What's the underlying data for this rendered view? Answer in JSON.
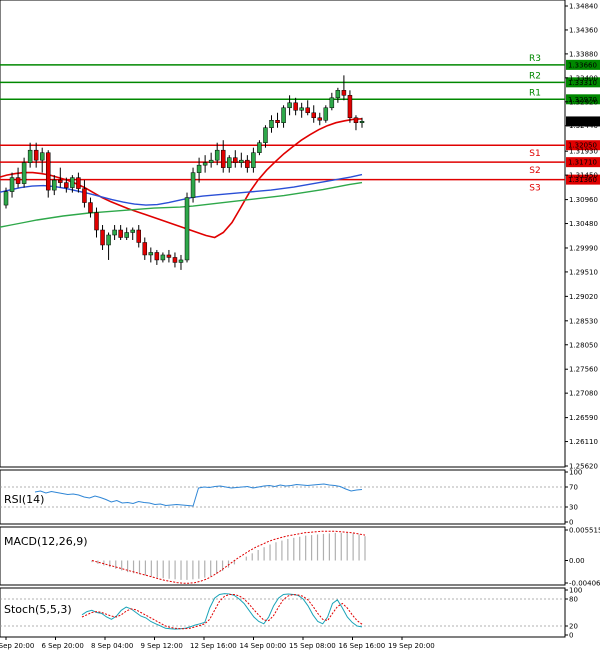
{
  "chart_data": {
    "type": "candlestick",
    "price_axis": {
      "ticks": [
        "1.34840",
        "1.34360",
        "1.33880",
        "1.33400",
        "1.32920",
        "1.32440",
        "1.31930",
        "1.31450",
        "1.30960",
        "1.30480",
        "1.29990",
        "1.29510",
        "1.29020",
        "1.28530",
        "1.28050",
        "1.27560",
        "1.27080",
        "1.26590",
        "1.26110",
        "1.25620"
      ],
      "range": [
        1.2562,
        1.3484
      ]
    },
    "time_axis": {
      "labels": [
        "5 Sep 20:00",
        "6 Sep 20:00",
        "8 Sep 04:00",
        "9 Sep 12:00",
        "12 Sep 16:00",
        "14 Sep 00:00",
        "15 Sep 08:00",
        "16 Sep 16:00",
        "19 Sep 20:00"
      ]
    },
    "levels": [
      {
        "name": "R3",
        "value": 1.3366,
        "label": "1.33660",
        "color": "#008800"
      },
      {
        "name": "R2",
        "value": 1.3331,
        "label": "1.33310",
        "color": "#008800"
      },
      {
        "name": "R1",
        "value": 1.3297,
        "label": "1.32970",
        "color": "#008800"
      },
      {
        "name": "S1",
        "value": 1.3205,
        "label": "1.32050",
        "color": "#e00000"
      },
      {
        "name": "S2",
        "value": 1.3171,
        "label": "1.31710",
        "color": "#e00000"
      },
      {
        "name": "S3",
        "value": 1.3136,
        "label": "1.31360",
        "color": "#e00000"
      }
    ],
    "current_price": {
      "value": 1.32526,
      "label": "1.32526"
    },
    "candles": [
      [
        1.3085,
        1.312,
        1.3078,
        1.3112
      ],
      [
        1.3112,
        1.315,
        1.31,
        1.314
      ],
      [
        1.314,
        1.316,
        1.312,
        1.3128
      ],
      [
        1.3128,
        1.318,
        1.312,
        1.317
      ],
      [
        1.317,
        1.321,
        1.316,
        1.3195
      ],
      [
        1.3195,
        1.321,
        1.316,
        1.3175
      ],
      [
        1.3175,
        1.32,
        1.315,
        1.319
      ],
      [
        1.319,
        1.3195,
        1.31,
        1.3115
      ],
      [
        1.3115,
        1.3145,
        1.3105,
        1.3135
      ],
      [
        1.3135,
        1.316,
        1.312,
        1.313
      ],
      [
        1.313,
        1.314,
        1.311,
        1.312
      ],
      [
        1.312,
        1.3145,
        1.311,
        1.314
      ],
      [
        1.314,
        1.315,
        1.311,
        1.3118
      ],
      [
        1.3118,
        1.3135,
        1.308,
        1.309
      ],
      [
        1.309,
        1.31,
        1.306,
        1.307
      ],
      [
        1.307,
        1.308,
        1.302,
        1.3035
      ],
      [
        1.3035,
        1.3045,
        1.2995,
        1.3005
      ],
      [
        1.3005,
        1.303,
        1.2975,
        1.3025
      ],
      [
        1.3025,
        1.3045,
        1.3015,
        1.3035
      ],
      [
        1.3035,
        1.3045,
        1.3015,
        1.302
      ],
      [
        1.302,
        1.304,
        1.3015,
        1.303
      ],
      [
        1.303,
        1.304,
        1.3015,
        1.3035
      ],
      [
        1.3035,
        1.3045,
        1.3,
        1.301
      ],
      [
        1.301,
        1.302,
        1.2975,
        1.2985
      ],
      [
        1.2985,
        1.3,
        1.297,
        1.299
      ],
      [
        1.299,
        1.2995,
        1.2965,
        1.2975
      ],
      [
        1.2975,
        1.299,
        1.297,
        1.2985
      ],
      [
        1.2985,
        1.2995,
        1.297,
        1.298
      ],
      [
        1.298,
        1.299,
        1.296,
        1.297
      ],
      [
        1.297,
        1.2985,
        1.2955,
        1.2975
      ],
      [
        1.2975,
        1.311,
        1.297,
        1.31
      ],
      [
        1.31,
        1.316,
        1.309,
        1.315
      ],
      [
        1.315,
        1.318,
        1.313,
        1.3165
      ],
      [
        1.3165,
        1.3185,
        1.315,
        1.317
      ],
      [
        1.317,
        1.319,
        1.316,
        1.3175
      ],
      [
        1.3175,
        1.321,
        1.3165,
        1.3195
      ],
      [
        1.3195,
        1.3215,
        1.315,
        1.316
      ],
      [
        1.316,
        1.3185,
        1.315,
        1.318
      ],
      [
        1.318,
        1.3195,
        1.316,
        1.317
      ],
      [
        1.317,
        1.319,
        1.316,
        1.3175
      ],
      [
        1.3175,
        1.3185,
        1.315,
        1.316
      ],
      [
        1.316,
        1.32,
        1.315,
        1.319
      ],
      [
        1.319,
        1.3215,
        1.3185,
        1.321
      ],
      [
        1.321,
        1.3245,
        1.32,
        1.324
      ],
      [
        1.324,
        1.3265,
        1.323,
        1.3255
      ],
      [
        1.3255,
        1.327,
        1.324,
        1.325
      ],
      [
        1.325,
        1.3285,
        1.324,
        1.328
      ],
      [
        1.328,
        1.3305,
        1.3265,
        1.329
      ],
      [
        1.329,
        1.33,
        1.3265,
        1.3275
      ],
      [
        1.3275,
        1.329,
        1.326,
        1.328
      ],
      [
        1.328,
        1.3295,
        1.3265,
        1.327
      ],
      [
        1.327,
        1.3285,
        1.325,
        1.326
      ],
      [
        1.326,
        1.327,
        1.3245,
        1.3255
      ],
      [
        1.3255,
        1.3285,
        1.325,
        1.328
      ],
      [
        1.328,
        1.331,
        1.3275,
        1.33
      ],
      [
        1.33,
        1.332,
        1.329,
        1.3315
      ],
      [
        1.3315,
        1.3345,
        1.3295,
        1.3305
      ],
      [
        1.3305,
        1.3315,
        1.325,
        1.326
      ],
      [
        1.326,
        1.3265,
        1.3235,
        1.325
      ],
      [
        1.325,
        1.326,
        1.324,
        1.3253
      ]
    ],
    "moving_averages": [
      {
        "color": "#e00000",
        "values": [
          1.314,
          1.3145,
          1.3148,
          1.315,
          1.315,
          1.3148,
          1.3145,
          1.314,
          1.3135,
          1.3128,
          1.312,
          1.311,
          1.31,
          1.3092,
          1.3085,
          1.3078,
          1.3072,
          1.3066,
          1.306,
          1.3054,
          1.3048,
          1.3042,
          1.3036,
          1.303,
          1.3024,
          1.302,
          1.303,
          1.305,
          1.308,
          1.311,
          1.3135,
          1.3155,
          1.3172,
          1.3188,
          1.3202,
          1.3215,
          1.3226,
          1.3236,
          1.3244,
          1.325,
          1.3254,
          1.3257,
          1.3258
        ]
      },
      {
        "color": "#2a4fd6",
        "values": [
          1.311,
          1.3115,
          1.312,
          1.3123,
          1.3124,
          1.3122,
          1.3118,
          1.3113,
          1.3108,
          1.3102,
          1.3096,
          1.3091,
          1.3087,
          1.3085,
          1.3086,
          1.309,
          1.3095,
          1.31,
          1.3103,
          1.3105,
          1.3107,
          1.3109,
          1.3111,
          1.3113,
          1.3115,
          1.3118,
          1.3121,
          1.3125,
          1.3129,
          1.3133,
          1.3137,
          1.3141,
          1.3146
        ]
      },
      {
        "color": "#2ea84a",
        "values": [
          1.304,
          1.3045,
          1.305,
          1.3055,
          1.3059,
          1.3063,
          1.3066,
          1.3069,
          1.3071,
          1.3073,
          1.3075,
          1.3077,
          1.3079,
          1.308,
          1.3081,
          1.3083,
          1.3086,
          1.3089,
          1.3092,
          1.3095,
          1.3098,
          1.3101,
          1.3104,
          1.3108,
          1.3112,
          1.3116,
          1.3121,
          1.3126,
          1.313
        ]
      }
    ],
    "rsi": {
      "title": "RSI(14)",
      "ticks": [
        "100",
        "70",
        "30",
        "0"
      ],
      "range": [
        0,
        100
      ],
      "levels": [
        70,
        30
      ],
      "values": [
        60,
        62,
        58,
        61,
        59,
        57,
        55,
        56,
        54,
        50,
        48,
        52,
        49,
        45,
        40,
        43,
        38,
        39,
        37,
        41,
        39,
        38,
        35,
        36,
        33,
        34,
        35,
        34,
        33,
        32,
        68,
        70,
        69,
        71,
        72,
        70,
        68,
        69,
        70,
        71,
        68,
        70,
        72,
        73,
        71,
        74,
        72,
        73,
        75,
        74,
        73,
        74,
        75,
        76,
        74,
        73,
        71,
        66,
        62,
        64,
        65
      ]
    },
    "macd": {
      "title": "MACD(12,26,9)",
      "ticks": [
        "0.005515",
        "0.00",
        "-0.004065"
      ],
      "range": [
        -0.004065,
        0.005515
      ],
      "histogram": [
        -0.0003,
        -0.0006,
        -0.0009,
        -0.0012,
        -0.0015,
        -0.0018,
        -0.0021,
        -0.0023,
        -0.0025,
        -0.0027,
        -0.0029,
        -0.0031,
        -0.0032,
        -0.0033,
        -0.0034,
        -0.0035,
        -0.0035,
        -0.0034,
        -0.0033,
        -0.0031,
        -0.0028,
        -0.0024,
        -0.0019,
        -0.0013,
        -0.0007,
        0.0,
        0.0007,
        0.0013,
        0.0019,
        0.0024,
        0.0029,
        0.0033,
        0.0036,
        0.0039,
        0.0041,
        0.0043,
        0.0045,
        0.0046,
        0.0047,
        0.0048,
        0.0049,
        0.005,
        0.005,
        0.005,
        0.0049,
        0.0047,
        0.0044
      ],
      "signal": [
        0.0,
        -0.0003,
        -0.0006,
        -0.0009,
        -0.0012,
        -0.0015,
        -0.0018,
        -0.0021,
        -0.0024,
        -0.0027,
        -0.003,
        -0.0033,
        -0.0036,
        -0.0038,
        -0.004,
        -0.0041,
        -0.0041,
        -0.004,
        -0.0037,
        -0.0033,
        -0.0027,
        -0.002,
        -0.0012,
        -0.0004,
        0.0004,
        0.0011,
        0.0018,
        0.0024,
        0.0029,
        0.0034,
        0.0038,
        0.0041,
        0.0044,
        0.0046,
        0.0048,
        0.005,
        0.0051,
        0.0052,
        0.0053,
        0.0053,
        0.0053,
        0.0052,
        0.0051,
        0.005,
        0.0048,
        0.0046
      ]
    },
    "stochastic": {
      "title": "Stoch(5,5,3)",
      "ticks": [
        "100",
        "80",
        "20",
        "0"
      ],
      "range": [
        0,
        100
      ],
      "levels": [
        80,
        20
      ],
      "main": [
        45,
        52,
        55,
        50,
        48,
        40,
        35,
        42,
        55,
        62,
        58,
        50,
        42,
        38,
        30,
        25,
        20,
        15,
        14,
        13,
        14,
        15,
        18,
        22,
        25,
        28,
        60,
        82,
        90,
        92,
        91,
        88,
        80,
        70,
        55,
        40,
        30,
        25,
        40,
        65,
        82,
        90,
        91,
        90,
        88,
        80,
        65,
        45,
        30,
        25,
        40,
        70,
        78,
        60,
        40,
        28,
        20,
        18
      ],
      "signal": [
        40,
        45,
        50,
        52,
        50,
        46,
        42,
        40,
        45,
        53,
        58,
        56,
        50,
        44,
        38,
        32,
        26,
        20,
        17,
        15,
        14,
        14,
        15,
        18,
        21,
        25,
        35,
        55,
        75,
        86,
        90,
        90,
        87,
        80,
        69,
        56,
        44,
        33,
        32,
        43,
        62,
        79,
        87,
        90,
        89,
        86,
        78,
        64,
        48,
        35,
        32,
        48,
        63,
        70,
        60,
        45,
        32,
        24
      ]
    }
  }
}
